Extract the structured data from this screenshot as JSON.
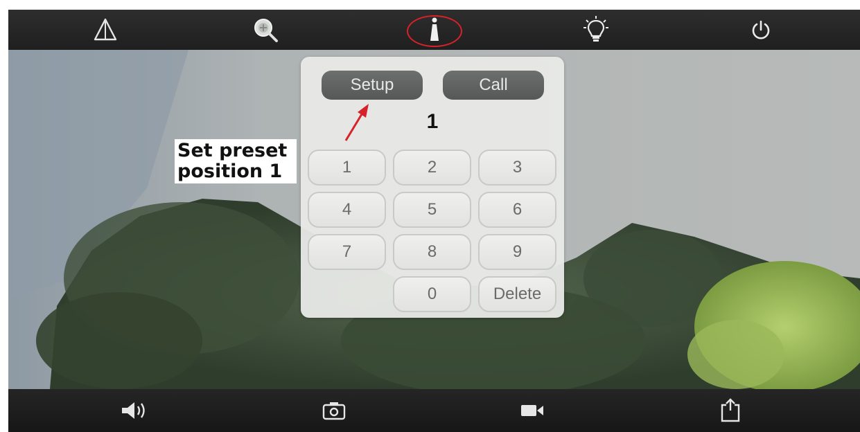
{
  "toolbar_top": {
    "icons": [
      "warning-icon",
      "zoom-icon",
      "preset-icon",
      "light-bulb-icon",
      "power-icon"
    ]
  },
  "toolbar_bottom": {
    "icons": [
      "speaker-icon",
      "snapshot-icon",
      "record-icon",
      "share-icon"
    ]
  },
  "annotation": {
    "line1": "Set preset",
    "line2": "position 1"
  },
  "keypad": {
    "setup_label": "Setup",
    "call_label": "Call",
    "display_value": "1",
    "keys": [
      "1",
      "2",
      "3",
      "4",
      "5",
      "6",
      "7",
      "8",
      "9",
      "0",
      "Delete"
    ]
  },
  "colors": {
    "highlight": "#d8222a",
    "mode_button": "#5f6160",
    "keypad_bg": "#e9eae8"
  }
}
